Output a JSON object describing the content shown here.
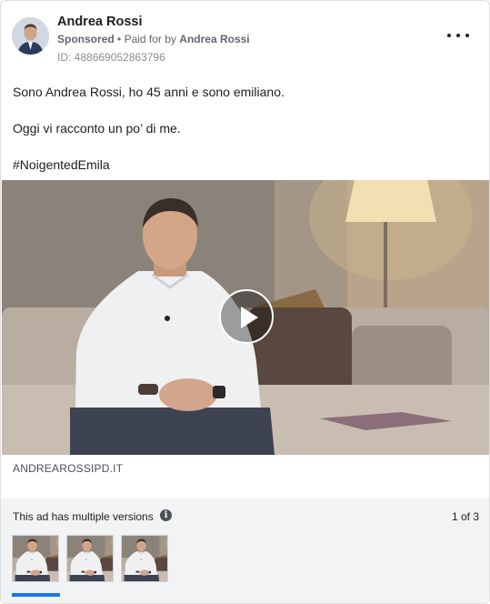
{
  "advertiser": {
    "name": "Andrea Rossi",
    "sponsored_label": "Sponsored",
    "separator": "•",
    "paid_for_prefix": "Paid for by",
    "paid_for_name": "Andrea Rossi",
    "ad_id": "ID: 488669052863796"
  },
  "post": {
    "line1": "Sono Andrea Rossi, ho 45 anni e sono emiliano.",
    "line2": "Oggi vi racconto un po’ di me.",
    "hashtag": "#NoigentedEmila"
  },
  "link": {
    "domain": "ANDREAROSSIPD.IT"
  },
  "versions": {
    "label": "This ad has multiple versions",
    "info_icon_glyph": "i",
    "pager": "1 of 3",
    "thumbnail_count": 3,
    "selected_index": 0
  },
  "icons": [
    "more-options-icon",
    "play-icon",
    "info-icon"
  ],
  "colors": {
    "accent": "#1877f2",
    "panel_bg": "#f2f3f5",
    "text": "#1c1e21",
    "secondary_text": "#65676b"
  }
}
